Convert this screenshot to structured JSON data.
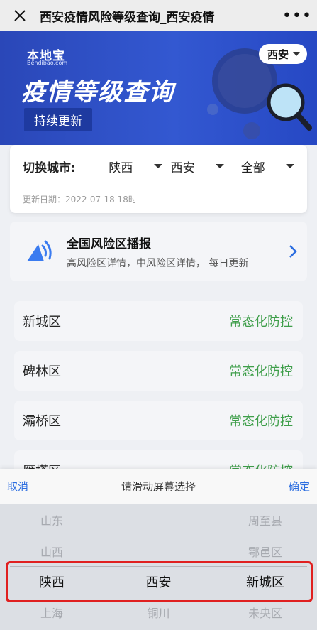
{
  "nav": {
    "title": "西安疫情风险等级查询_西安疫情"
  },
  "banner": {
    "logo": "本地宝",
    "logo_sub": "Bendibao.com",
    "headline": "疫情等级查询",
    "tag": "持续更新",
    "city": "西安"
  },
  "switch": {
    "label": "切换城市:",
    "province": "陕西",
    "city": "西安",
    "district": "全部",
    "update": "更新日期：2022-07-18 18时"
  },
  "risk": {
    "title": "全国风险区播报",
    "desc": "高风险区详情，中风险区详情， 每日更新"
  },
  "districts": [
    {
      "name": "新城区",
      "status": "常态化防控"
    },
    {
      "name": "碑林区",
      "status": "常态化防控"
    },
    {
      "name": "灞桥区",
      "status": "常态化防控"
    },
    {
      "name": "雁塔区",
      "status": "常态化防控"
    }
  ],
  "picker": {
    "cancel": "取消",
    "title": "请滑动屏幕选择",
    "confirm": "确定",
    "rows": [
      [
        "山东",
        "",
        "周至县"
      ],
      [
        "山西",
        "",
        "鄠邑区"
      ],
      [
        "陕西",
        "西安",
        "新城区"
      ],
      [
        "上海",
        "铜川",
        "未央区"
      ]
    ]
  },
  "colors": {
    "accent": "#2b6de0",
    "status": "#3e9e4a",
    "banner": "#3358d1",
    "highlight": "#e02020"
  }
}
